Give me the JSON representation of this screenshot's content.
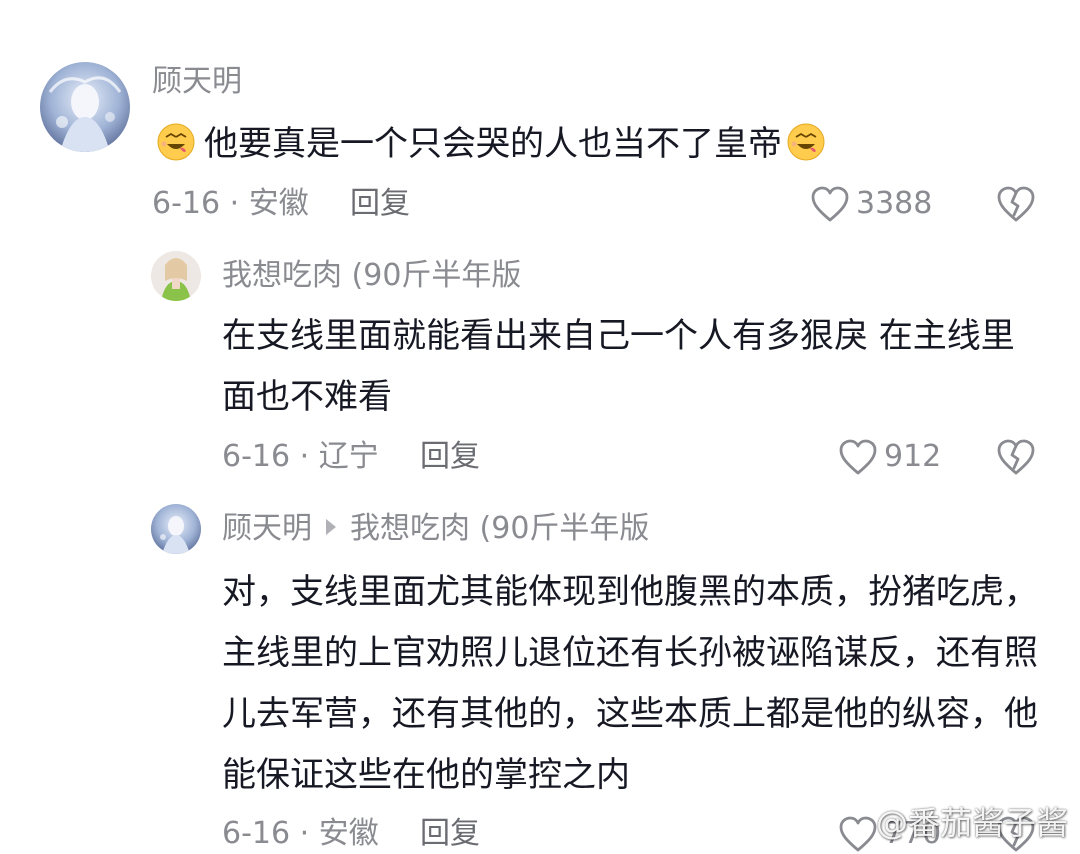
{
  "comments": [
    {
      "username": "顾天明",
      "text": "他要真是一个只会哭的人也当不了皇帝",
      "emoji": "drooling-face-emoji",
      "date_location": "6-16 · 安徽",
      "reply_label": "回复",
      "likes": "3388"
    },
    {
      "username": "我想吃肉 (90斤半年版",
      "text": "在支线里面就能看出来自己一个人有多狠戾 在主线里面也不难看",
      "date_location": "6-16 · 辽宁",
      "reply_label": "回复",
      "likes": "912"
    },
    {
      "username": "顾天明",
      "reply_to": "我想吃肉 (90斤半年版",
      "text": "对，支线里面尤其能体现到他腹黑的本质，扮猪吃虎，主线里的上官劝照儿退位还有长孙被诬陷谋反，还有照儿去军营，还有其他的，这些本质上都是他的纵容，他能保证这些在他的掌控之内",
      "date_location": "6-16 · 安徽",
      "reply_label": "回复",
      "likes": "770"
    }
  ],
  "watermark": "@番茄酱子酱",
  "icons": {
    "like": "heart-outline-icon",
    "dislike": "broken-heart-icon",
    "reply_arrow": "caret-right-icon"
  },
  "colors": {
    "text_primary": "#161823",
    "text_secondary": "#8a8b91"
  }
}
